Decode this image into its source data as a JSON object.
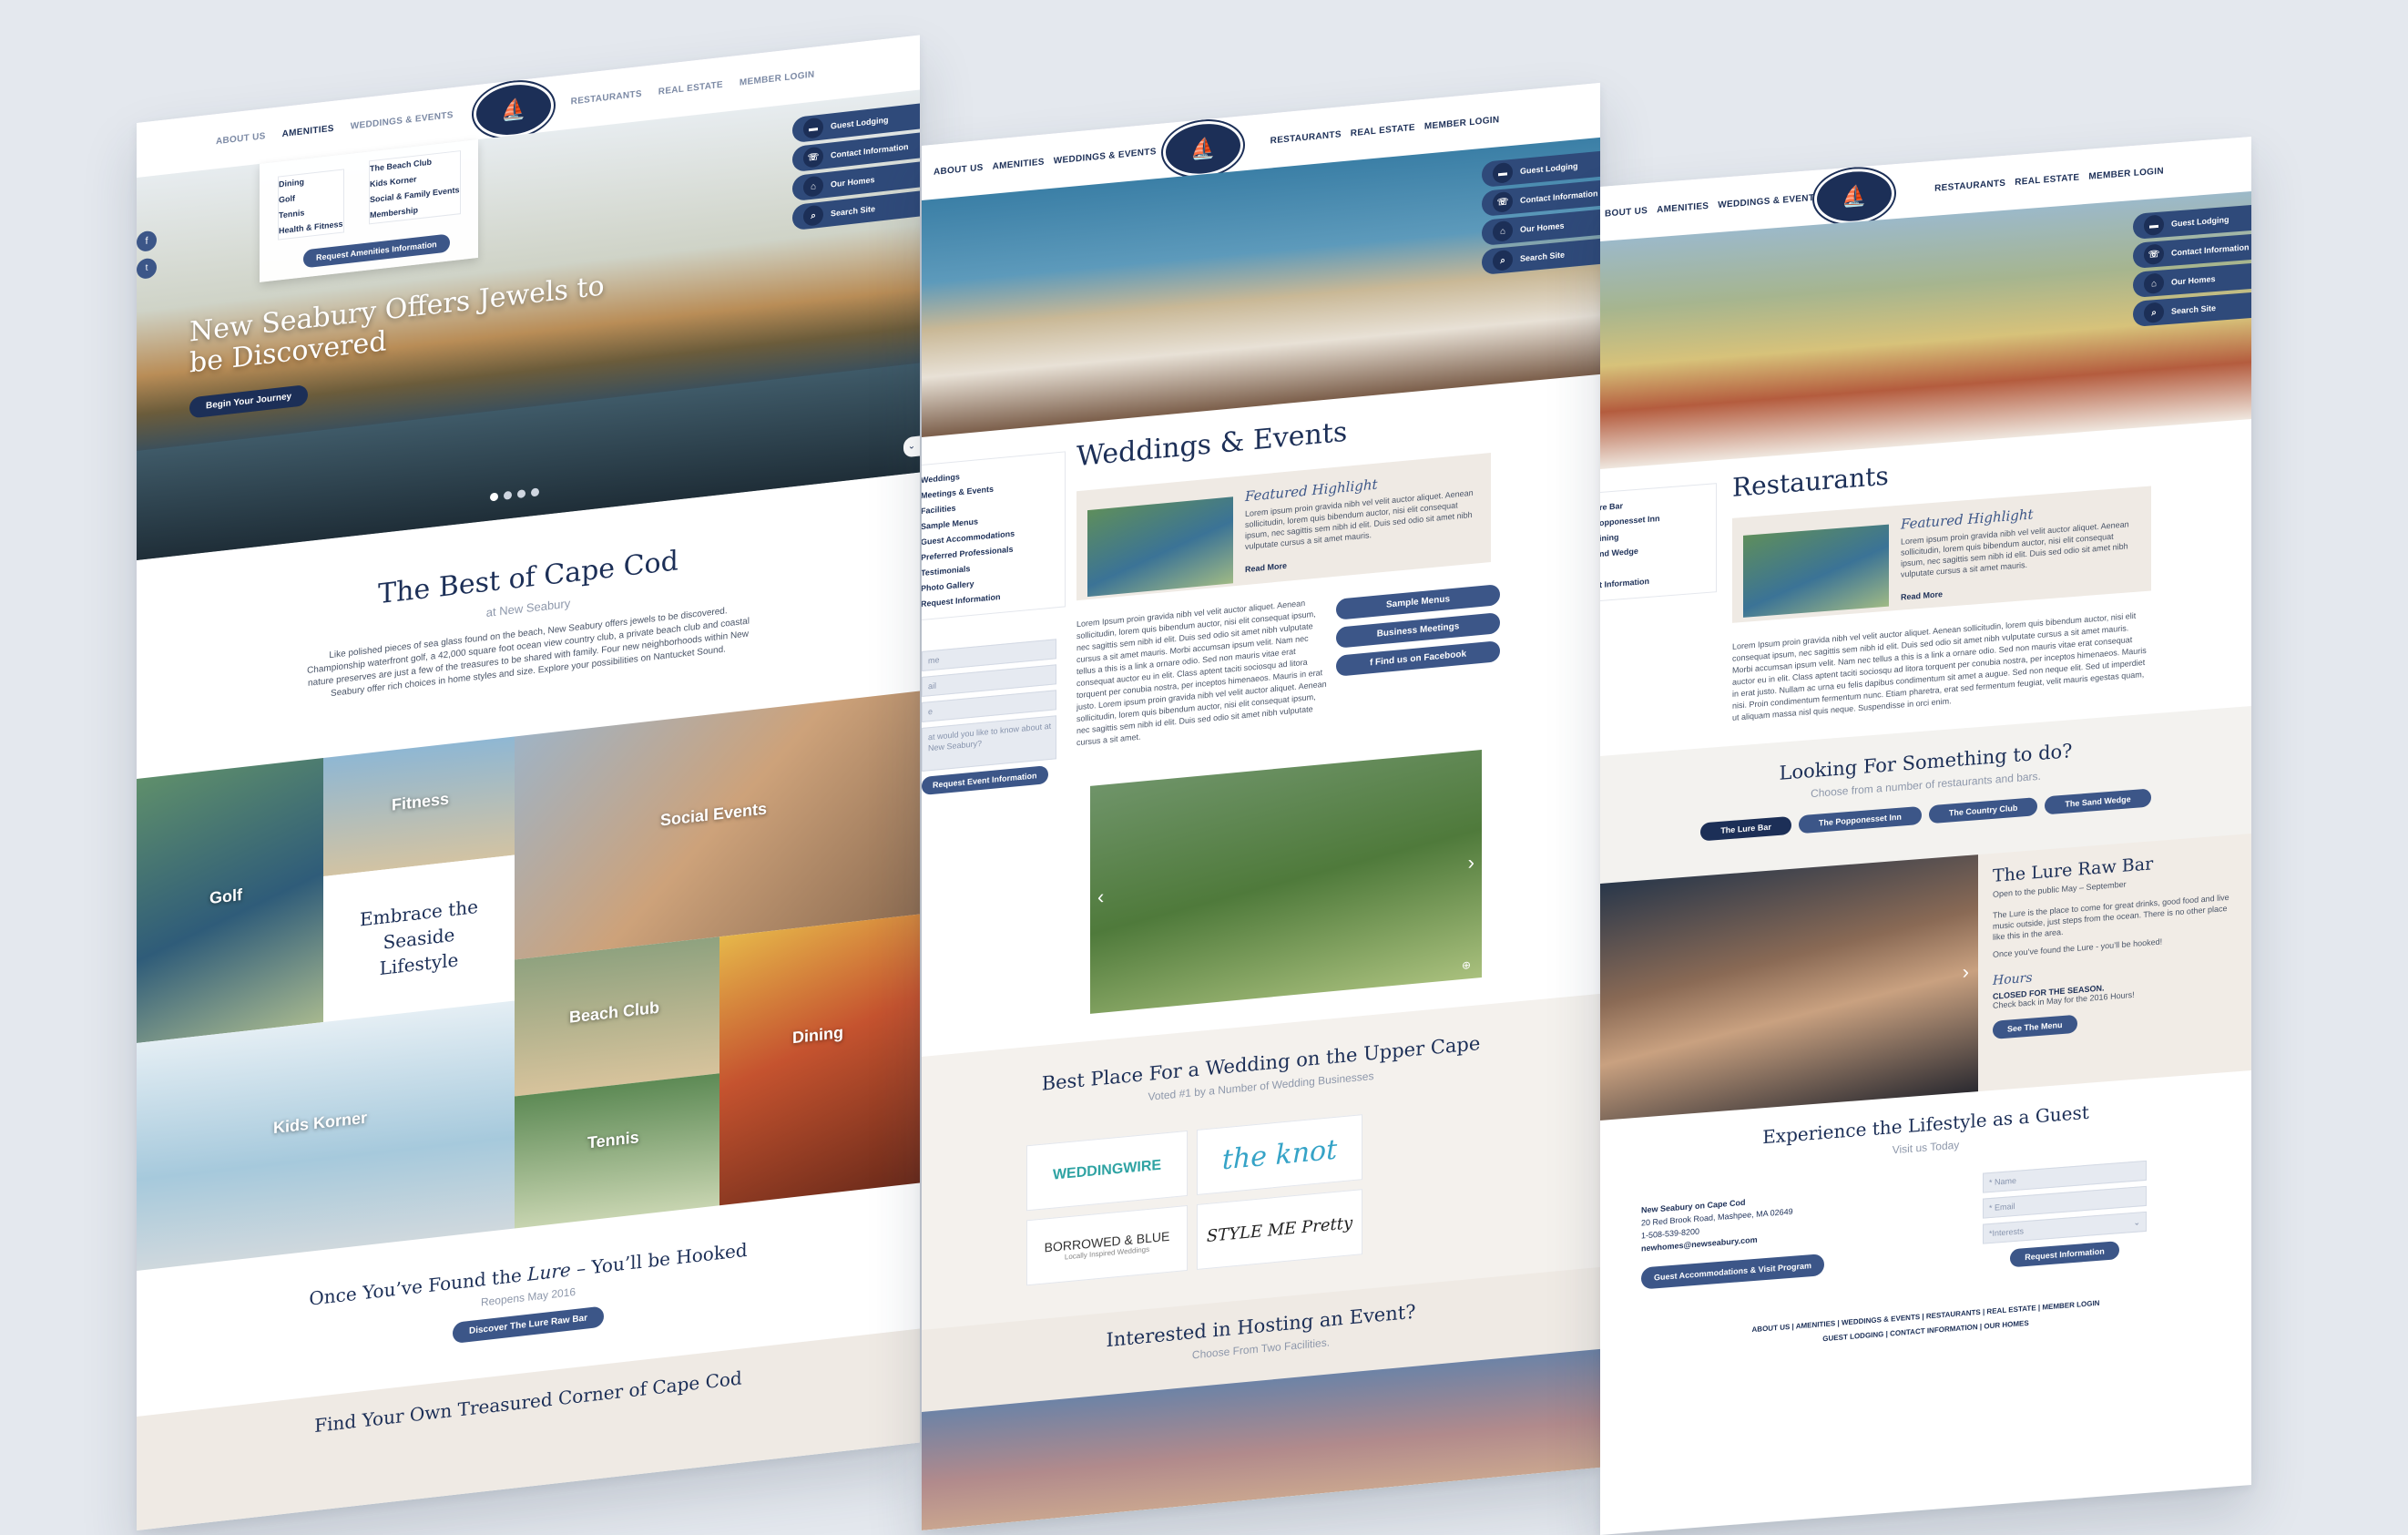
{
  "colors": {
    "navy": "#1c2f57",
    "accent": "#3c5688",
    "bg": "#e4e8ee",
    "sand": "#efeae4"
  },
  "page1": {
    "nav": {
      "about": "ABOUT US",
      "amenities": "AMENITIES",
      "weddings": "WEDDINGS & EVENTS",
      "restaurants": "RESTAURANTS",
      "real_estate": "REAL ESTATE",
      "member_login": "MEMBER LOGIN"
    },
    "dropdown": {
      "col1": [
        "Dining",
        "Golf",
        "Tennis",
        "Health & Fitness"
      ],
      "col2": [
        "The Beach Club",
        "Kids Korner",
        "Social & Family Events",
        "Membership"
      ],
      "button": "Request Amenities Information"
    },
    "side": [
      "Guest Lodging",
      "Contact Information",
      "Our Homes",
      "Search Site"
    ],
    "hero": {
      "title": "New Seabury Offers Jewels to be Discovered",
      "button": "Begin Your Journey"
    },
    "intro": {
      "title": "The Best of Cape Cod",
      "subtitle": "at New Seabury",
      "text": "Like polished pieces of sea glass found on the beach, New Seabury offers jewels to be discovered. Championship waterfront golf, a 42,000 square foot ocean view country club, a private beach club and coastal nature preserves are just a few of the treasures to be shared with family. Four new neighborhoods within New Seabury offer rich choices in home styles and size. Explore your possibilities on Nantucket Sound."
    },
    "tiles": {
      "golf": "Golf",
      "fitness": "Fitness",
      "social": "Social Events",
      "embrace": "Embrace the Seaside Lifestyle",
      "beach": "Beach Club",
      "dining": "Dining",
      "kids": "Kids Korner",
      "tennis": "Tennis"
    },
    "lure": {
      "title_pre": "Once You’ve Found the ",
      "title_em": "Lure",
      "title_post": " – You’ll be Hooked",
      "sub": "Reopens May 2016",
      "button": "Discover The Lure Raw Bar"
    },
    "footer_title": "Find Your Own Treasured Corner of Cape Cod"
  },
  "page2": {
    "nav": {
      "about": "ABOUT US",
      "amenities": "AMENITIES",
      "weddings": "WEDDINGS & EVENTS",
      "restaurants": "RESTAURANTS",
      "real_estate": "REAL ESTATE",
      "member_login": "MEMBER LOGIN"
    },
    "side": [
      "Guest Lodging",
      "Contact Information",
      "Our Homes",
      "Search Site"
    ],
    "title": "Weddings & Events",
    "submenu": [
      "Weddings",
      "Meetings & Events",
      "Facilities",
      "Sample Menus",
      "Guest Accommodations",
      "Preferred Professionals",
      "Testimonials",
      "Photo Gallery",
      "Request Information"
    ],
    "form": {
      "f1": "me",
      "f2": "ail",
      "f3": "e",
      "q": "at would you like to know about at New Seabury?",
      "button": "Request Event Information"
    },
    "highlight": {
      "label": "Featured Highlight",
      "text": "Lorem ipsum proin gravida nibh vel velit auctor aliquet. Aenean sollicitudin, lorem quis bibendum auctor, nisi elit consequat ipsum, nec sagittis sem nibh id elit. Duis sed odio sit amet nibh vulputate cursus a sit amet mauris.",
      "link": "Read More"
    },
    "body": "Lorem Ipsum proin gravida nibh vel velit auctor aliquet. Aenean sollicitudin, lorem quis bibendum auctor, nisi elit consequat ipsum, nec sagittis sem nibh id elit. Duis sed odio sit amet nibh vulputate cursus a sit amet mauris. Morbi accumsan ipsum velit. Nam nec tellus a this is a link a ornare odio. Sed non mauris vitae erat consequat auctor eu in elit. Class aptent taciti sociosqu ad litora torquent per conubia nostra, per inceptos himenaeos. Mauris in erat justo. Lorem ipsum proin gravida nibh vel velit auctor aliquet. Aenean sollicitudin, lorem quis bibendum auctor, nisi elit consequat ipsum, nec sagittis sem nibh id elit. Duis sed odio sit amet nibh vulputate cursus a sit amet.",
    "buttons": [
      "Sample Menus",
      "Business Meetings",
      "Find us on Facebook"
    ],
    "best": {
      "title": "Best Place For a Wedding on the Upper Cape",
      "sub": "Voted #1 by a Number of Wedding Businesses"
    },
    "logos": [
      "WEDDINGWIRE",
      "the knot",
      "BORROWED & BLUE",
      "STYLE ME Pretty"
    ],
    "logo_sub": "Locally Inspired Weddings",
    "hosting": {
      "title": "Interested in Hosting an Event?",
      "sub": "Choose From Two Facilities."
    }
  },
  "page3": {
    "nav": {
      "about": "BOUT US",
      "amenities": "AMENITIES",
      "weddings": "WEDDINGS & EVENTS",
      "restaurants": "RESTAURANTS",
      "real_estate": "REAL ESTATE",
      "member_login": "MEMBER LOGIN"
    },
    "side": [
      "Guest Lodging",
      "Contact Information",
      "Our Homes",
      "Search Site"
    ],
    "title": "Restaurants",
    "submenu": [
      "re Bar",
      "opponesset Inn",
      "ining",
      "nd Wedge",
      "",
      "t Information"
    ],
    "highlight": {
      "label": "Featured Highlight",
      "text": "Lorem ipsum proin gravida nibh vel velit auctor aliquet. Aenean sollicitudin, lorem quis bibendum auctor, nisi elit consequat ipsum, nec sagittis sem nibh id elit. Duis sed odio sit amet nibh vulputate cursus a sit amet mauris.",
      "link": "Read More"
    },
    "body": "Lorem Ipsum proin gravida nibh vel velit auctor aliquet. Aenean sollicitudin, lorem quis bibendum auctor, nisi elit consequat ipsum, nec sagittis sem nibh id elit. Duis sed odio sit amet nibh vulputate cursus a sit amet mauris. Morbi accumsan ipsum velit. Nam nec tellus a this is a link a ornare odio. Sed non mauris vitae erat consequat auctor eu in elit. Class aptent taciti sociosqu ad litora torquent per conubia nostra, per inceptos himenaeos. Mauris in erat justo. Nullam ac urna eu felis dapibus condimentum sit amet a augue. Sed non neque elit. Sed ut imperdiet nisi. Proin condimentum fermentum nunc. Etiam pharetra, erat sed fermentum feugiat, velit mauris egestas quam, ut aliquam massa nisl quis neque. Suspendisse in orci enim.",
    "looking": {
      "title": "Looking For Something to do?",
      "sub": "Choose from a number of restaurants and bars.",
      "tabs": [
        "The Lure Bar",
        "The Popponesset Inn",
        "The Country Club",
        "The Sand Wedge"
      ]
    },
    "lure": {
      "title": "The Lure Raw Bar",
      "open": "Open to the public May – September",
      "text": "The Lure is the place to come for great drinks, good food and live music outside, just steps from the ocean. There is no other place like this in the area.",
      "text2": "Once you’ve found the Lure - you’ll be hooked!",
      "hours_label": "Hours",
      "closed": "CLOSED FOR THE SEASON.",
      "check": "Check back in May for the 2016 Hours!",
      "button": "See The Menu"
    },
    "guest": {
      "title": "Experience the Lifestyle as a Guest",
      "sub": "Visit us Today",
      "name": "New Seabury on Cape Cod",
      "address": "20 Red Brook Road, Mashpee, MA 02649",
      "phone": "1-508-539-8200",
      "email": "newhomes@newseabury.com",
      "button": "Guest Accommodations & Visit Program",
      "fields": [
        "* Name",
        "* Email",
        "*Interests"
      ],
      "req": "Request Information"
    },
    "footer": {
      "row1": [
        "ABOUT US",
        "AMENITIES",
        "WEDDINGS & EVENTS",
        "RESTAURANTS",
        "REAL ESTATE",
        "MEMBER LOGIN"
      ],
      "row2": [
        "GUEST LODGING",
        "CONTACT INFORMATION",
        "OUR HOMES"
      ]
    }
  }
}
